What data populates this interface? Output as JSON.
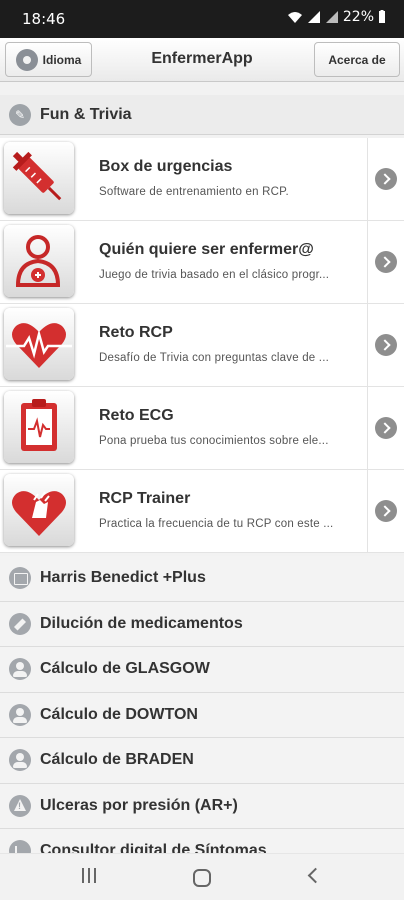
{
  "status_bar": {
    "time": "18:46",
    "battery": "22%"
  },
  "header": {
    "title": "EnfermerApp",
    "left_button": "Idioma",
    "right_button": "Acerca de"
  },
  "section": {
    "label": "Fun & Trivia"
  },
  "rich_items": [
    {
      "title": "Box de urgencias",
      "subtitle": "Software de entrenamiento en RCP.",
      "icon": "syringe-icon"
    },
    {
      "title": "Quién quiere ser enfermer@",
      "subtitle": "Juego de trivia basado en el clásico progr...",
      "icon": "doctor-icon"
    },
    {
      "title": "Reto RCP",
      "subtitle": "Desafío de Trivia con preguntas clave de ...",
      "icon": "heart-pulse-icon"
    },
    {
      "title": "Reto ECG",
      "subtitle": "Pona prueba tus conocimientos sobre ele...",
      "icon": "clipboard-ecg-icon"
    },
    {
      "title": "RCP Trainer",
      "subtitle": "Practica la frecuencia de tu RCP con este ...",
      "icon": "heart-hands-icon"
    }
  ],
  "plain_items": [
    {
      "label": "Harris Benedict +Plus",
      "icon": "calendar-icon"
    },
    {
      "label": "Dilución de medicamentos",
      "icon": "tag-icon"
    },
    {
      "label": "Cálculo de GLASGOW",
      "icon": "person-icon"
    },
    {
      "label": "Cálculo de DOWTON",
      "icon": "person-icon"
    },
    {
      "label": "Cálculo de BRADEN",
      "icon": "person-icon"
    },
    {
      "label": "Ulceras por presión (AR+)",
      "icon": "warning-icon"
    },
    {
      "label": "Consultor digital de Síntomas",
      "icon": "chart-icon"
    }
  ],
  "colors": {
    "accent_red": "#d32f2f",
    "header_bg": "#ffffff",
    "list_bg": "#f3f3f3"
  }
}
